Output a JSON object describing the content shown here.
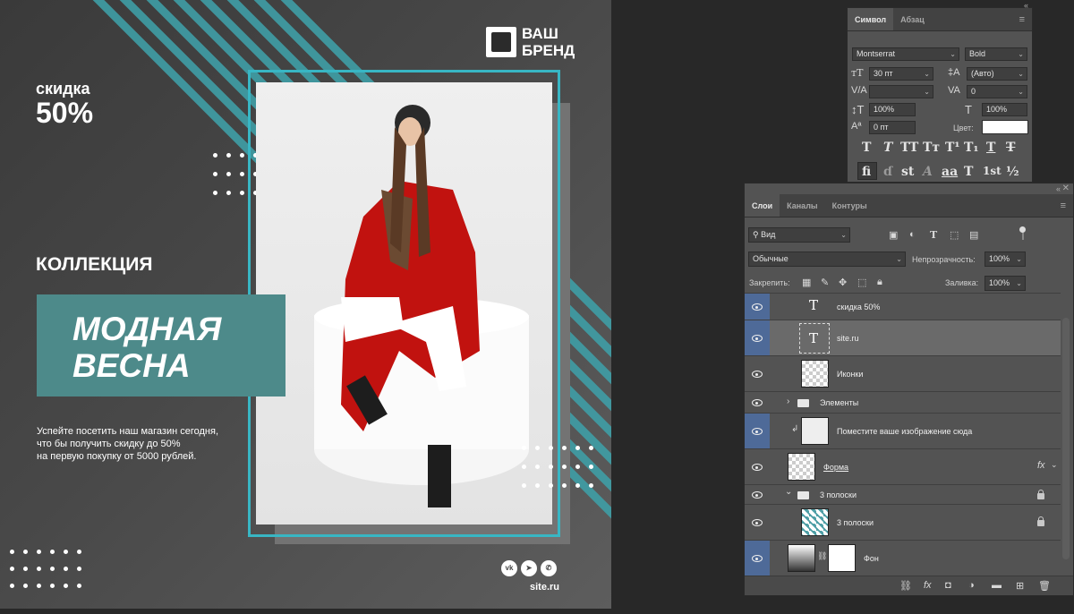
{
  "poster": {
    "discount_line1": "скидка",
    "discount_line2": "50%",
    "brand_line1": "ВАШ",
    "brand_line2": "БРЕНД",
    "collection": "КОЛЛЕКЦИЯ",
    "headline_line1": "МОДНАЯ",
    "headline_line2": "ВЕСНА",
    "desc_line1": "Успейте посетить наш магазин сегодня,",
    "desc_line2": "что бы получить скидку до 50%",
    "desc_line3": "на первую покупку от 5000 рублей.",
    "site": "site.ru",
    "social": [
      "vk-icon",
      "telegram-icon",
      "viber-icon"
    ],
    "accent": "#38b6c4",
    "box_color": "#4d8a8a",
    "coat_color": "#c1120f"
  },
  "char_panel": {
    "tabs": [
      "Символ",
      "Абзац"
    ],
    "font_family": "Montserrat",
    "font_style": "Bold",
    "font_size": "30 пт",
    "leading": "(Авто)",
    "kerning": "",
    "tracking": "0",
    "vertical_scale": "100%",
    "horizontal_scale": "100%",
    "baseline_shift": "0 пт",
    "color_label": "Цвет:",
    "style_row1": [
      "T",
      "T",
      "TT",
      "Tт",
      "T¹",
      "T₁",
      "T",
      "T"
    ],
    "style_row2": [
      "fi",
      "ɗ",
      "st",
      "A",
      "aa",
      "T",
      "1st",
      "½"
    ]
  },
  "layers_panel": {
    "tabs": [
      "Слои",
      "Каналы",
      "Контуры"
    ],
    "filter": "Вид",
    "blend_mode": "Обычные",
    "opacity_label": "Непрозрачность:",
    "opacity": "100%",
    "lock_label": "Закрепить:",
    "fill_label": "Заливка:",
    "fill": "100%",
    "layers": [
      {
        "name": "скидка 50%",
        "kind": "text"
      },
      {
        "name": "site.ru",
        "kind": "text"
      },
      {
        "name": "Иконки",
        "kind": "pixel"
      },
      {
        "name": "Элементы",
        "kind": "group"
      },
      {
        "name": "Поместите ваше изображение сюда",
        "kind": "smart"
      },
      {
        "name": "Форма",
        "kind": "shape"
      },
      {
        "name": "3 полоски",
        "kind": "group"
      },
      {
        "name": "3 полоски",
        "kind": "shape"
      },
      {
        "name": "Фон",
        "kind": "pixel"
      }
    ]
  }
}
